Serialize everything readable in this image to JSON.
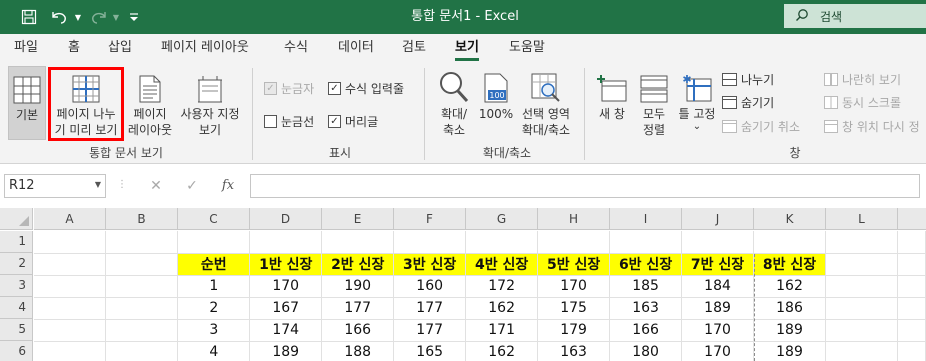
{
  "app": {
    "title": "통합 문서1  -  Excel",
    "accent_color": "#217346"
  },
  "quick_access": {
    "save_icon": "save-icon",
    "undo_icon": "undo-icon",
    "redo_icon": "redo-icon",
    "customize_icon": "customize-icon"
  },
  "search": {
    "label": "검색",
    "icon": "search-icon"
  },
  "tabs": [
    {
      "label": "파일"
    },
    {
      "label": "홈"
    },
    {
      "label": "삽입"
    },
    {
      "label": "페이지 레이아웃"
    },
    {
      "label": "수식"
    },
    {
      "label": "데이터"
    },
    {
      "label": "검토"
    },
    {
      "label": "보기",
      "active": true
    },
    {
      "label": "도움말"
    }
  ],
  "ribbon": {
    "workbook_views": {
      "group_label": "통합 문서 보기",
      "normal": {
        "label": "기본",
        "pressed": true
      },
      "page_break_preview": {
        "line1": "페이지 나누",
        "line2": "기 미리 보기",
        "highlighted": true
      },
      "page_layout": {
        "line1": "페이지",
        "line2": "레이아웃"
      },
      "custom_views": {
        "line1": "사용자 지정",
        "line2": "보기"
      }
    },
    "show": {
      "group_label": "표시",
      "ruler": {
        "label": "눈금자",
        "checked": true,
        "disabled": true
      },
      "formula_bar": {
        "label": "수식 입력줄",
        "checked": true
      },
      "gridlines": {
        "label": "눈금선",
        "checked": false
      },
      "headings": {
        "label": "머리글",
        "checked": true
      }
    },
    "zoom": {
      "group_label": "확대/축소",
      "zoom": {
        "line1": "확대/",
        "line2": "축소"
      },
      "zoom100": {
        "label": "100%",
        "badge": "100"
      },
      "zoom_selection": {
        "line1": "선택 영역",
        "line2": "확대/축소"
      }
    },
    "window": {
      "group_label": "창",
      "new_window": {
        "label": "새 창"
      },
      "arrange_all": {
        "line1": "모두",
        "line2": "정렬"
      },
      "freeze_panes": {
        "label": "틀 고정",
        "dropdown": "⌄"
      },
      "split": {
        "label": "나누기"
      },
      "hide": {
        "label": "숨기기"
      },
      "unhide": {
        "label": "숨기기 취소",
        "disabled": true
      },
      "view_side_by_side": {
        "label": "나란히 보기",
        "disabled": true
      },
      "sync_scroll": {
        "label": "동시 스크롤",
        "disabled": true
      },
      "reset_position": {
        "label": "창 위치 다시 정",
        "disabled": true
      }
    }
  },
  "formula_bar": {
    "name_box": "R12",
    "cancel_icon": "✕",
    "enter_icon": "✓",
    "fx": "fx",
    "value": ""
  },
  "sheet": {
    "columns": [
      "A",
      "B",
      "C",
      "D",
      "E",
      "F",
      "G",
      "H",
      "I",
      "J",
      "K",
      "L"
    ],
    "rows": [
      "1",
      "2",
      "3",
      "4",
      "5",
      "6"
    ],
    "header_row": [
      "순번",
      "1반 신장",
      "2반 신장",
      "3반 신장",
      "4반 신장",
      "5반 신장",
      "6반 신장",
      "7반 신장",
      "8반 신장"
    ],
    "data_rows": [
      [
        "1",
        "170",
        "190",
        "160",
        "172",
        "170",
        "185",
        "184",
        "162"
      ],
      [
        "2",
        "167",
        "177",
        "177",
        "162",
        "175",
        "163",
        "189",
        "186"
      ],
      [
        "3",
        "174",
        "166",
        "177",
        "171",
        "179",
        "166",
        "170",
        "189"
      ],
      [
        "4",
        "189",
        "188",
        "165",
        "162",
        "163",
        "180",
        "170",
        "189"
      ]
    ],
    "header_fill": "#ffff00",
    "selected_cell": "R12"
  }
}
